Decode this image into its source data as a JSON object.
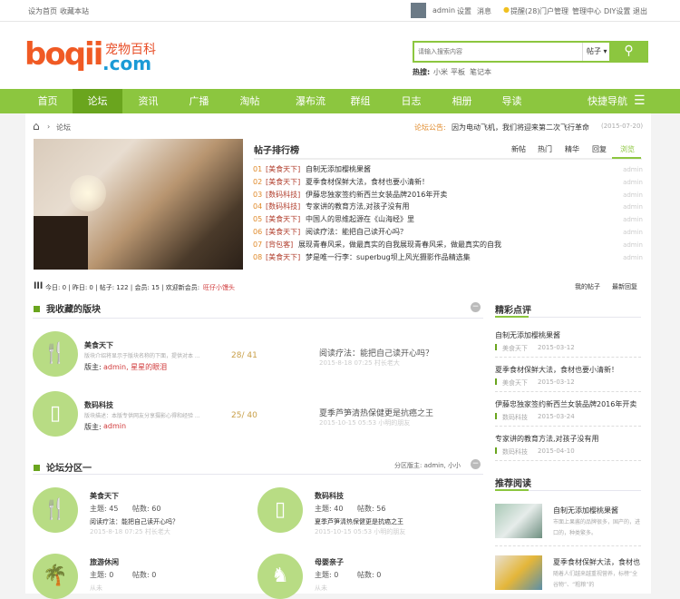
{
  "topbar": {
    "left": [
      "设为首页",
      "收藏本站"
    ],
    "user": "admin",
    "links": [
      "设置",
      "消息",
      "提醒(28)",
      "门户管理",
      "管理中心",
      "DIY设置",
      "退出"
    ]
  },
  "logo": {
    "text": "boqii",
    "domain": ".com",
    "slogan": "宠物百科"
  },
  "search": {
    "placeholder": "请输入搜索内容",
    "type": "帖子",
    "hot_label": "热搜:",
    "hot": [
      "小米",
      "平板",
      "笔记本"
    ]
  },
  "nav": {
    "items": [
      "首页",
      "论坛",
      "资讯",
      "广播",
      "淘帖",
      "瀑布流",
      "群组",
      "日志",
      "相册",
      "导读"
    ],
    "quick": "快捷导航"
  },
  "breadcrumb": {
    "current": "论坛"
  },
  "notice": {
    "label": "论坛公告:",
    "text": "因为电动飞机，我们将迎来第二次飞行革命",
    "date": "(2015-07-20)"
  },
  "ranking": {
    "title": "帖子排行榜",
    "tabs": [
      "新帖",
      "热门",
      "精华",
      "回复",
      "浏览"
    ],
    "items": [
      {
        "no": "01",
        "cat": "[美食天下]",
        "title": "自制无添加樱桃果酱",
        "author": "admin"
      },
      {
        "no": "02",
        "cat": "[美食天下]",
        "title": "夏季食材保鲜大法，食材也要小清新！",
        "author": "admin"
      },
      {
        "no": "03",
        "cat": "[数码科技]",
        "title": "伊藤忠独家签约新西兰女装品牌2016年开卖",
        "author": "admin"
      },
      {
        "no": "04",
        "cat": "[数码科技]",
        "title": "专家讲的教育方法,对孩子没有用",
        "author": "admin"
      },
      {
        "no": "05",
        "cat": "[美食天下]",
        "title": "中国人的思维起源在《山海经》里",
        "author": "admin"
      },
      {
        "no": "06",
        "cat": "[美食天下]",
        "title": "阅读疗法：能把自己读开心吗？",
        "author": "admin"
      },
      {
        "no": "07",
        "cat": "[背包客]",
        "title": "展现青春风采，做最真实的自我展现青春风采，做最真实的自我",
        "author": "admin"
      },
      {
        "no": "08",
        "cat": "[美食天下]",
        "title": "梦是唯一行李：superbug坝上风光摄影作品精选集",
        "author": "admin"
      }
    ]
  },
  "stats": {
    "text": "今日: 0 | 昨日: 0 | 帖子: 122 | 会员: 15 | 欢迎新会员:",
    "newest": "旺仔小馒头",
    "links": [
      "我的帖子",
      "最新回复"
    ]
  },
  "fav": {
    "title": "我收藏的版块",
    "forums": [
      {
        "name": "美食天下",
        "desc": "版块介绍将显示于版块名称的下面，提供对本 ...",
        "count": "28/ 41",
        "mod_label": "版主:",
        "mods": "admin, 星星的眼泪",
        "last": "阅读疗法：能把自己读开心吗？",
        "last_meta": "2015-8-18 07:25 村长老大"
      },
      {
        "name": "数码科技",
        "desc": "版块描述：本版专供网友分享摄影心得和经验 ...",
        "count": "25/ 40",
        "mod_label": "版主:",
        "mods": "admin",
        "last": "夏季芦笋清热保健更是抗癌之王",
        "last_meta": "2015-10-15 05:53 小明的朋友"
      }
    ]
  },
  "zone": {
    "title": "论坛分区一",
    "mods": "分区版主: admin, 小小",
    "forums": [
      {
        "name": "美食天下",
        "topics": "主题: 45",
        "posts": "帖数: 60",
        "last": "阅读疗法：能把自己读开心吗？",
        "meta": "2015-8-18 07:25 村长老大"
      },
      {
        "name": "数码科技",
        "topics": "主题: 40",
        "posts": "帖数: 56",
        "last": "夏季芦笋清热保健更是抗癌之王",
        "meta": "2015-10-15 05:53 小明的朋友"
      },
      {
        "name": "旅游休闲",
        "topics": "主题: 0",
        "posts": "帖数: 0",
        "last": "",
        "meta": "从未"
      },
      {
        "name": "母婴亲子",
        "topics": "主题: 0",
        "posts": "帖数: 0",
        "last": "",
        "meta": "从未"
      }
    ]
  },
  "reviews": {
    "title": "精彩点评",
    "items": [
      {
        "title": "自制无添加樱桃果酱",
        "cat": "美食天下",
        "date": "2015-03-12"
      },
      {
        "title": "夏季食材保鲜大法，食材也要小清新！",
        "cat": "美食天下",
        "date": "2015-03-12"
      },
      {
        "title": "伊藤忠独家签约新西兰女装品牌2016年开卖",
        "cat": "数码科技",
        "date": "2015-03-24"
      },
      {
        "title": "专家讲的教育方法,对孩子没有用",
        "cat": "数码科技",
        "date": "2015-04-10"
      }
    ]
  },
  "recommend": {
    "title": "推荐阅读",
    "items": [
      {
        "title": "自制无添加樱桃果酱",
        "desc": "市面上果酱的品牌很多，国产的，进口的，种类繁多。"
      },
      {
        "title": "夏季食材保鲜大法，食材也",
        "desc": "随着人们越来越重视营养，标榜“全谷物”、“粗粮”的"
      }
    ]
  }
}
